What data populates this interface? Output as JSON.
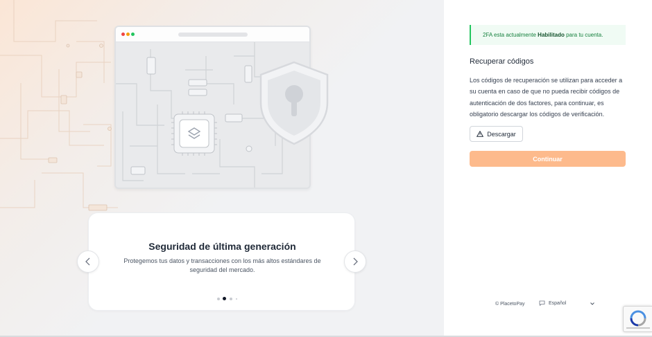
{
  "carousel": {
    "slide_title": "Seguridad de última generación",
    "slide_text": "Protegemos tus datos y transacciones con los más altos estándares de seguridad del mercado.",
    "pagination_count": 4,
    "active_index": 1,
    "prev_icon": "chevron-left-icon",
    "next_icon": "chevron-right-icon"
  },
  "alert": {
    "prefix": "2FA esta actualmente",
    "status": "Habilitado",
    "suffix": "para tu cuenta."
  },
  "recovery": {
    "title": "Recuperar códigos",
    "description": "Los códigos de recuperación se utilizan para acceder a su cuenta en caso de que no pueda recibir códigos de autenticación de dos factores, para continuar, es obligatorio descargar los códigos de verificación.",
    "download_label": "Descargar",
    "download_icon": "warning-triangle-icon",
    "continue_label": "Continuar"
  },
  "footer": {
    "copyright": "© PlacetoPay",
    "language": "Español",
    "language_icon": "chat-bubble-icon"
  },
  "colors": {
    "accent": "#fdba8c",
    "success": "#22c55e",
    "text_dark": "#1f2937"
  }
}
